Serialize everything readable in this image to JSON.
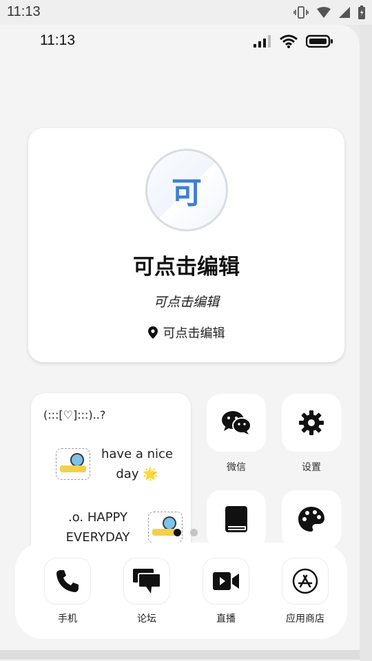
{
  "system_bar": {
    "time": "11:13"
  },
  "phone_status": {
    "time": "11:13"
  },
  "profile": {
    "avatar_char": "可",
    "name": "可点击编辑",
    "subtitle": "可点击编辑",
    "location": "可点击编辑"
  },
  "note_widget": {
    "title": "(:::[♡]:::)..?",
    "line1": "have a nice day 🌟",
    "line2": ".o. HAPPY EVERYDAY"
  },
  "apps": [
    {
      "label": "微信",
      "icon": "wechat-icon"
    },
    {
      "label": "设置",
      "icon": "gear-icon"
    },
    {
      "label": "",
      "icon": "book-icon"
    },
    {
      "label": "",
      "icon": "palette-icon"
    }
  ],
  "page_dots": {
    "count": 2,
    "active": 1
  },
  "dock": [
    {
      "label": "手机",
      "icon": "phone-icon"
    },
    {
      "label": "论坛",
      "icon": "chat-bubbles-icon"
    },
    {
      "label": "直播",
      "icon": "video-camera-icon"
    },
    {
      "label": "应用商店",
      "icon": "app-store-icon"
    }
  ],
  "colors": {
    "accent": "#3f7fd6",
    "dot_active": "#111111",
    "dot_inactive": "#c4c4c4"
  }
}
